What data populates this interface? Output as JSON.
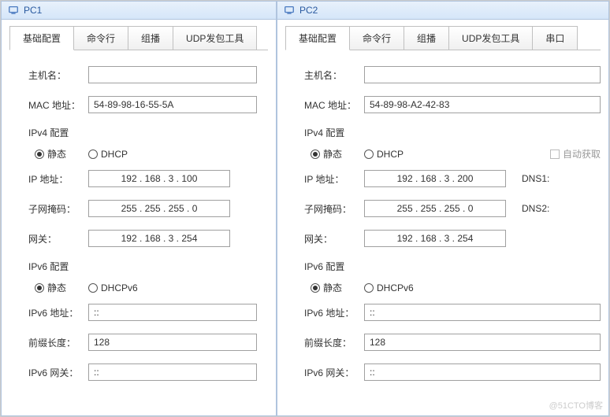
{
  "watermark": "@51CTO博客",
  "pc1": {
    "title": "PC1",
    "tabs": [
      "基础配置",
      "命令行",
      "组播",
      "UDP发包工具"
    ],
    "activeTab": 0,
    "hostLabel": "主机名：",
    "hostValue": "",
    "macLabel": "MAC 地址：",
    "macValue": "54-89-98-16-55-5A",
    "ipv4": {
      "title": "IPv4 配置",
      "static": "静态",
      "dhcp": "DHCP",
      "ipLabel": "IP 地址：",
      "ip": "192 . 168 . 3 . 100",
      "maskLabel": "子网掩码：",
      "mask": "255 . 255 . 255 . 0",
      "gwLabel": "网关：",
      "gw": "192 . 168 . 3 . 254"
    },
    "ipv6": {
      "title": "IPv6 配置",
      "static": "静态",
      "dhcp": "DHCPv6",
      "ipLabel": "IPv6 地址：",
      "ip": "::",
      "prefixLabel": "前缀长度：",
      "prefix": "128",
      "gwLabel": "IPv6 网关：",
      "gw": "::"
    }
  },
  "pc2": {
    "title": "PC2",
    "tabs": [
      "基础配置",
      "命令行",
      "组播",
      "UDP发包工具",
      "串口"
    ],
    "activeTab": 0,
    "hostLabel": "主机名：",
    "hostValue": "",
    "macLabel": "MAC 地址：",
    "macValue": "54-89-98-A2-42-83",
    "autoDnsLabel": "自动获取",
    "dns1Label": "DNS1:",
    "dns2Label": "DNS2:",
    "ipv4": {
      "title": "IPv4 配置",
      "static": "静态",
      "dhcp": "DHCP",
      "ipLabel": "IP 地址：",
      "ip": "192 . 168 . 3 . 200",
      "maskLabel": "子网掩码：",
      "mask": "255 . 255 . 255 . 0",
      "gwLabel": "网关：",
      "gw": "192 . 168 . 3 . 254"
    },
    "ipv6": {
      "title": "IPv6 配置",
      "static": "静态",
      "dhcp": "DHCPv6",
      "ipLabel": "IPv6 地址：",
      "ip": "::",
      "prefixLabel": "前缀长度：",
      "prefix": "128",
      "gwLabel": "IPv6 网关：",
      "gw": "::"
    }
  }
}
